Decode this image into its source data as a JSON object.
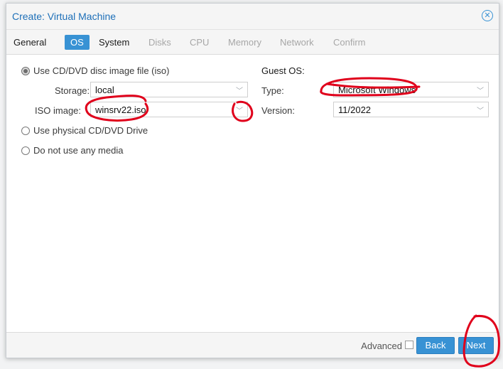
{
  "window": {
    "title": "Create: Virtual Machine"
  },
  "tabs": [
    {
      "label": "General",
      "state": "normal"
    },
    {
      "label": "OS",
      "state": "active"
    },
    {
      "label": "System",
      "state": "normal"
    },
    {
      "label": "Disks",
      "state": "disabled"
    },
    {
      "label": "CPU",
      "state": "disabled"
    },
    {
      "label": "Memory",
      "state": "disabled"
    },
    {
      "label": "Network",
      "state": "disabled"
    },
    {
      "label": "Confirm",
      "state": "disabled"
    }
  ],
  "media": {
    "option_iso": "Use CD/DVD disc image file (iso)",
    "storage_label": "Storage:",
    "storage_value": "local",
    "iso_label": "ISO image:",
    "iso_value": "winsrv22.iso",
    "option_physical": "Use physical CD/DVD Drive",
    "option_none": "Do not use any media"
  },
  "guest_os": {
    "heading": "Guest OS:",
    "type_label": "Type:",
    "type_value": "Microsoft Windows",
    "version_label": "Version:",
    "version_value": "11/2022"
  },
  "footer": {
    "advanced_label": "Advanced",
    "back_label": "Back",
    "next_label": "Next"
  },
  "colors": {
    "accent": "#3892d4",
    "title_text": "#1d6fb8",
    "annotation": "#e0001b"
  }
}
